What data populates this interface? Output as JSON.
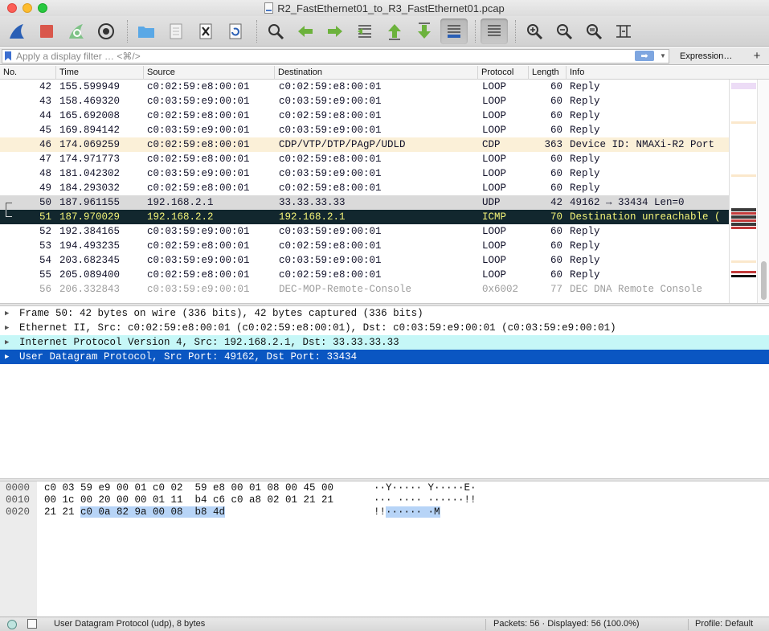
{
  "window": {
    "title": "R2_FastEthernet01_to_R3_FastEthernet01.pcap"
  },
  "toolbar": {
    "buttons": [
      "start-capture",
      "stop-capture",
      "restart-capture",
      "capture-options",
      "open-file",
      "save-file",
      "close-file",
      "reload-file",
      "find-packet",
      "go-back",
      "go-forward",
      "go-to-packet",
      "go-first",
      "go-last",
      "autoscroll",
      "colorize",
      "zoom-in",
      "zoom-out",
      "zoom-normal",
      "resize-columns"
    ]
  },
  "filter": {
    "placeholder": "Apply a display filter … <⌘/>",
    "expression_label": "Expression…",
    "add_label": "+"
  },
  "packet_list": {
    "columns": [
      "No.",
      "Time",
      "Source",
      "Destination",
      "Protocol",
      "Length",
      "Info"
    ],
    "rows": [
      {
        "no": "42",
        "time": "155.599949",
        "src": "c0:02:59:e8:00:01",
        "dst": "c0:02:59:e8:00:01",
        "proto": "LOOP",
        "len": "60",
        "info": "Reply",
        "style": "loop"
      },
      {
        "no": "43",
        "time": "158.469320",
        "src": "c0:03:59:e9:00:01",
        "dst": "c0:03:59:e9:00:01",
        "proto": "LOOP",
        "len": "60",
        "info": "Reply",
        "style": "loop"
      },
      {
        "no": "44",
        "time": "165.692008",
        "src": "c0:02:59:e8:00:01",
        "dst": "c0:02:59:e8:00:01",
        "proto": "LOOP",
        "len": "60",
        "info": "Reply",
        "style": "loop"
      },
      {
        "no": "45",
        "time": "169.894142",
        "src": "c0:03:59:e9:00:01",
        "dst": "c0:03:59:e9:00:01",
        "proto": "LOOP",
        "len": "60",
        "info": "Reply",
        "style": "loop"
      },
      {
        "no": "46",
        "time": "174.069259",
        "src": "c0:02:59:e8:00:01",
        "dst": "CDP/VTP/DTP/PAgP/UDLD",
        "proto": "CDP",
        "len": "363",
        "info": "Device ID: NMAXi-R2  Port",
        "style": "cdp"
      },
      {
        "no": "47",
        "time": "174.971773",
        "src": "c0:02:59:e8:00:01",
        "dst": "c0:02:59:e8:00:01",
        "proto": "LOOP",
        "len": "60",
        "info": "Reply",
        "style": "loop"
      },
      {
        "no": "48",
        "time": "181.042302",
        "src": "c0:03:59:e9:00:01",
        "dst": "c0:03:59:e9:00:01",
        "proto": "LOOP",
        "len": "60",
        "info": "Reply",
        "style": "loop"
      },
      {
        "no": "49",
        "time": "184.293032",
        "src": "c0:02:59:e8:00:01",
        "dst": "c0:02:59:e8:00:01",
        "proto": "LOOP",
        "len": "60",
        "info": "Reply",
        "style": "loop"
      },
      {
        "no": "50",
        "time": "187.961155",
        "src": "192.168.2.1",
        "dst": "33.33.33.33",
        "proto": "UDP",
        "len": "42",
        "info": "49162 → 33434 Len=0",
        "style": "udp"
      },
      {
        "no": "51",
        "time": "187.970029",
        "src": "192.168.2.2",
        "dst": "192.168.2.1",
        "proto": "ICMP",
        "len": "70",
        "info": "Destination unreachable (",
        "style": "icmp"
      },
      {
        "no": "52",
        "time": "192.384165",
        "src": "c0:03:59:e9:00:01",
        "dst": "c0:03:59:e9:00:01",
        "proto": "LOOP",
        "len": "60",
        "info": "Reply",
        "style": "loop"
      },
      {
        "no": "53",
        "time": "194.493235",
        "src": "c0:02:59:e8:00:01",
        "dst": "c0:02:59:e8:00:01",
        "proto": "LOOP",
        "len": "60",
        "info": "Reply",
        "style": "loop"
      },
      {
        "no": "54",
        "time": "203.682345",
        "src": "c0:03:59:e9:00:01",
        "dst": "c0:03:59:e9:00:01",
        "proto": "LOOP",
        "len": "60",
        "info": "Reply",
        "style": "loop"
      },
      {
        "no": "55",
        "time": "205.089400",
        "src": "c0:02:59:e8:00:01",
        "dst": "c0:02:59:e8:00:01",
        "proto": "LOOP",
        "len": "60",
        "info": "Reply",
        "style": "loop"
      },
      {
        "no": "56",
        "time": "206.332843",
        "src": "c0:03:59:e9:00:01",
        "dst": "DEC-MOP-Remote-Console",
        "proto": "0x6002",
        "len": "77",
        "info": "DEC DNA Remote Console",
        "style": "dec"
      }
    ]
  },
  "details": {
    "rows": [
      {
        "text": "Frame 50: 42 bytes on wire (336 bits), 42 bytes captured (336 bits)",
        "style": "plain"
      },
      {
        "text": "Ethernet II, Src: c0:02:59:e8:00:01 (c0:02:59:e8:00:01), Dst: c0:03:59:e9:00:01 (c0:03:59:e9:00:01)",
        "style": "plain"
      },
      {
        "text": "Internet Protocol Version 4, Src: 192.168.2.1, Dst: 33.33.33.33",
        "style": "ip"
      },
      {
        "text": "User Datagram Protocol, Src Port: 49162, Dst Port: 33434",
        "style": "udp"
      }
    ]
  },
  "bytes": {
    "rows": [
      {
        "offset": "0000",
        "hex": "c0 03 59 e9 00 01 c0 02  59 e8 00 01 08 00 45 00",
        "ascii": "··Y····· Y·····E·"
      },
      {
        "offset": "0010",
        "hex": "00 1c 00 20 00 00 01 11  b4 c6 c0 a8 02 01 21 21",
        "ascii": "··· ···· ······!!"
      },
      {
        "offset": "0020",
        "hex_plain": "21 21 ",
        "hex_hl": "c0 0a 82 9a 00 08  b8 4d",
        "ascii_plain": "!!",
        "ascii_hl": "······ ·M"
      }
    ]
  },
  "status": {
    "left": "User Datagram Protocol (udp), 8 bytes",
    "packets": "Packets: 56 · Displayed: 56 (100.0%)",
    "profile": "Profile: Default"
  },
  "colors": {
    "icmp_bg": "#12272e",
    "icmp_fg": "#f4f478",
    "udp_bg": "#dadada",
    "cdp_bg": "#fbf0d8",
    "ip_detail_bg": "#c6f7f7",
    "selected_detail_bg": "#0a56c2",
    "bytes_highlight": "#b7d4f7"
  }
}
